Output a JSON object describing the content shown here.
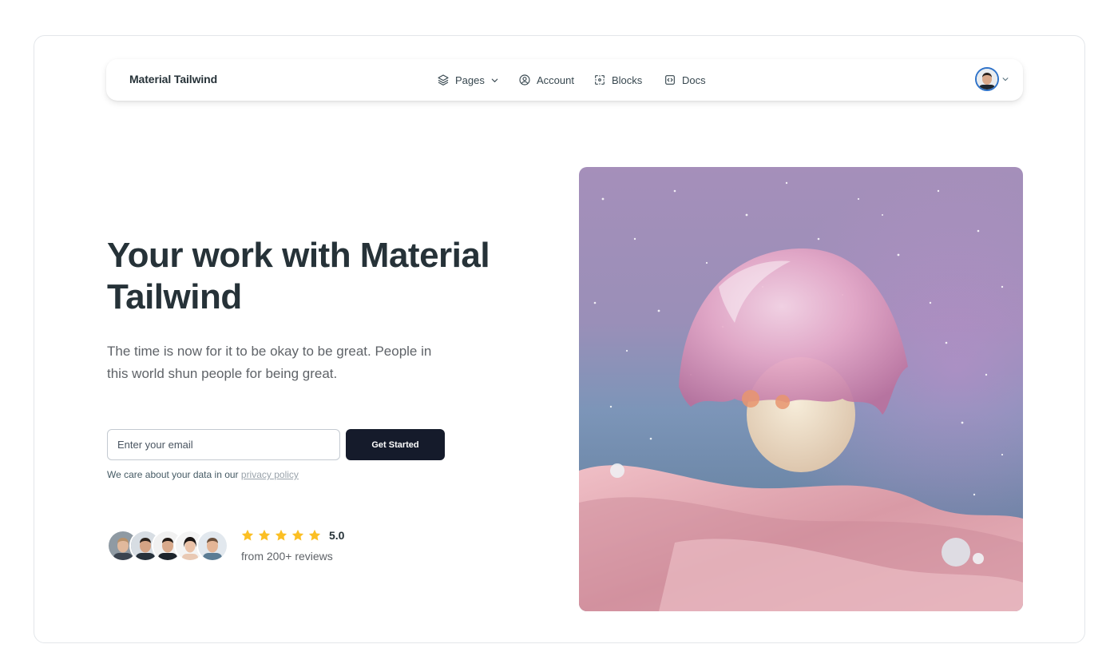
{
  "navbar": {
    "brand": "Material Tailwind",
    "items": [
      {
        "label": "Pages",
        "icon": "layers-icon",
        "has_dropdown": true
      },
      {
        "label": "Account",
        "icon": "user-circle-icon"
      },
      {
        "label": "Blocks",
        "icon": "blocks-icon"
      },
      {
        "label": "Docs",
        "icon": "code-bracket-icon"
      }
    ],
    "user_menu": {
      "icon": "chevron-down-icon"
    }
  },
  "hero": {
    "title": "Your work with Material Tailwind",
    "subtitle": "The time is now for it to be okay to be great. People in this world shun people for being great.",
    "email_placeholder": "Enter your email",
    "cta_label": "Get Started",
    "privacy_text": "We care about your data in our ",
    "privacy_link": "privacy policy",
    "rating": {
      "stars": 5,
      "value": "5.0",
      "reviews_text": "from 200+ reviews"
    }
  },
  "colors": {
    "primary_dark": "#151b2b",
    "heading": "#263238",
    "star": "#fbbf24",
    "avatar_ring": "#2f73c9"
  }
}
